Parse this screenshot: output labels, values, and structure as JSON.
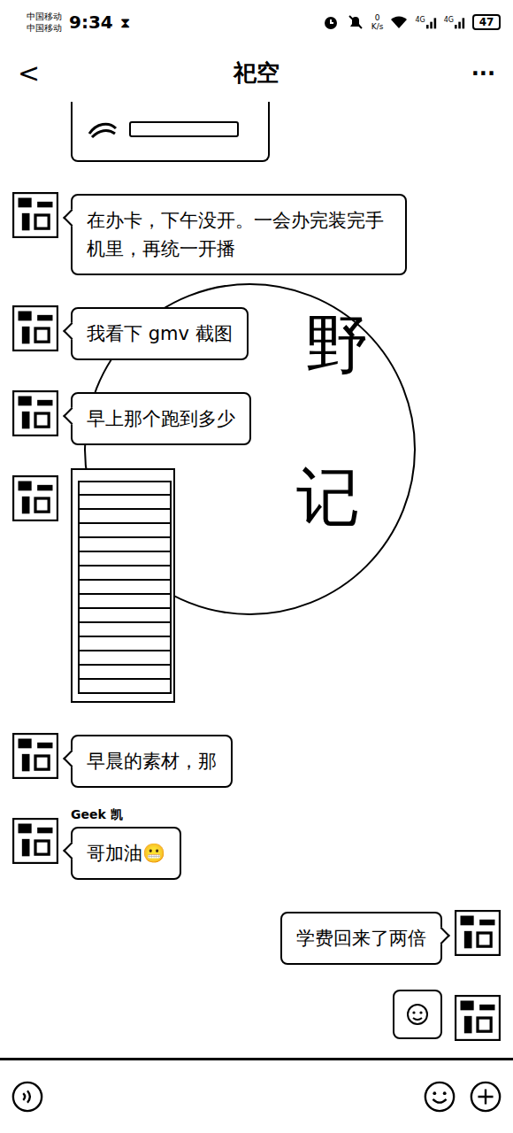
{
  "status_bar": {
    "carriers": [
      "中国移动",
      "中国移动"
    ],
    "time": "9:34",
    "hourglass": "⧗",
    "speed_value": "0",
    "speed_unit": "K/s",
    "network_labels": [
      "4G",
      "4G"
    ],
    "battery": "47"
  },
  "title_bar": {
    "back": "<",
    "title": "祀空",
    "menu": "···"
  },
  "watermark": {
    "chars": [
      "野",
      "记"
    ]
  },
  "messages": [
    {
      "side": "left",
      "kind": "image",
      "name": "",
      "text": ""
    },
    {
      "side": "left",
      "kind": "text",
      "name": "",
      "text": "在办卡，下午没开。一会办完装完手机里，再统一开播"
    },
    {
      "side": "left",
      "kind": "text",
      "name": "",
      "text": "我看下 gmv 截图"
    },
    {
      "side": "left",
      "kind": "text",
      "name": "",
      "text": "早上那个跑到多少"
    },
    {
      "side": "left",
      "kind": "screenshot",
      "name": "",
      "text": ""
    },
    {
      "side": "left",
      "kind": "text",
      "name": "",
      "text": "早晨的素材，那"
    },
    {
      "side": "left",
      "kind": "text",
      "name": "Geek 凯",
      "text": "哥加油😬"
    },
    {
      "side": "right",
      "kind": "text",
      "name": "",
      "text": "学费回来了两倍"
    },
    {
      "side": "right",
      "kind": "sticker",
      "name": "",
      "text": ""
    }
  ]
}
